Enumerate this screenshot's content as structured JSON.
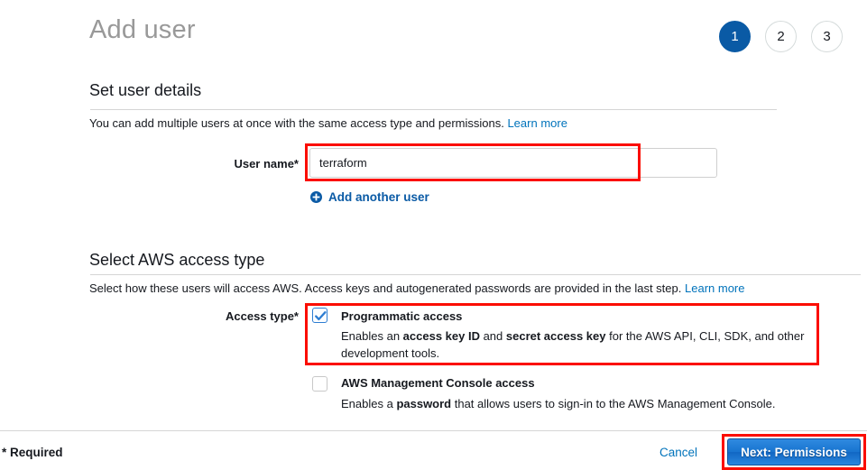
{
  "header": {
    "title": "Add user",
    "steps": [
      {
        "label": "1",
        "active": true
      },
      {
        "label": "2",
        "active": false
      },
      {
        "label": "3",
        "active": false
      }
    ]
  },
  "user_details": {
    "heading": "Set user details",
    "description": "You can add multiple users at once with the same access type and permissions.",
    "learn_more": "Learn more",
    "username_label": "User name*",
    "username_value": "terraform",
    "username_placeholder": "",
    "add_another_user": "Add another user",
    "plus_icon": "plus-circle-icon"
  },
  "access_type": {
    "heading": "Select AWS access type",
    "description": "Select how these users will access AWS. Access keys and autogenerated passwords are provided in the last step.",
    "learn_more": "Learn more",
    "label": "Access type*",
    "options": [
      {
        "title": "Programmatic access",
        "checked": true,
        "desc_part1": "Enables an ",
        "desc_bold1": "access key ID",
        "desc_part2": " and ",
        "desc_bold2": "secret access key",
        "desc_part3": " for the AWS API, CLI, SDK, and other development tools."
      },
      {
        "title": "AWS Management Console access",
        "checked": false,
        "desc_part1": "Enables a ",
        "desc_bold1": "password",
        "desc_part2": " that allows users to sign-in to the AWS Management Console.",
        "desc_bold2": "",
        "desc_part3": ""
      }
    ]
  },
  "footer": {
    "required_note": "* Required",
    "cancel_label": "Cancel",
    "next_label": "Next: Permissions"
  },
  "colors": {
    "accent_blue": "#0a5aa5",
    "link_blue": "#0073bb",
    "button_blue": "#1874cf",
    "annotation_red": "#fb0d00",
    "title_gray": "#999999",
    "text_dark": "#16191f"
  }
}
